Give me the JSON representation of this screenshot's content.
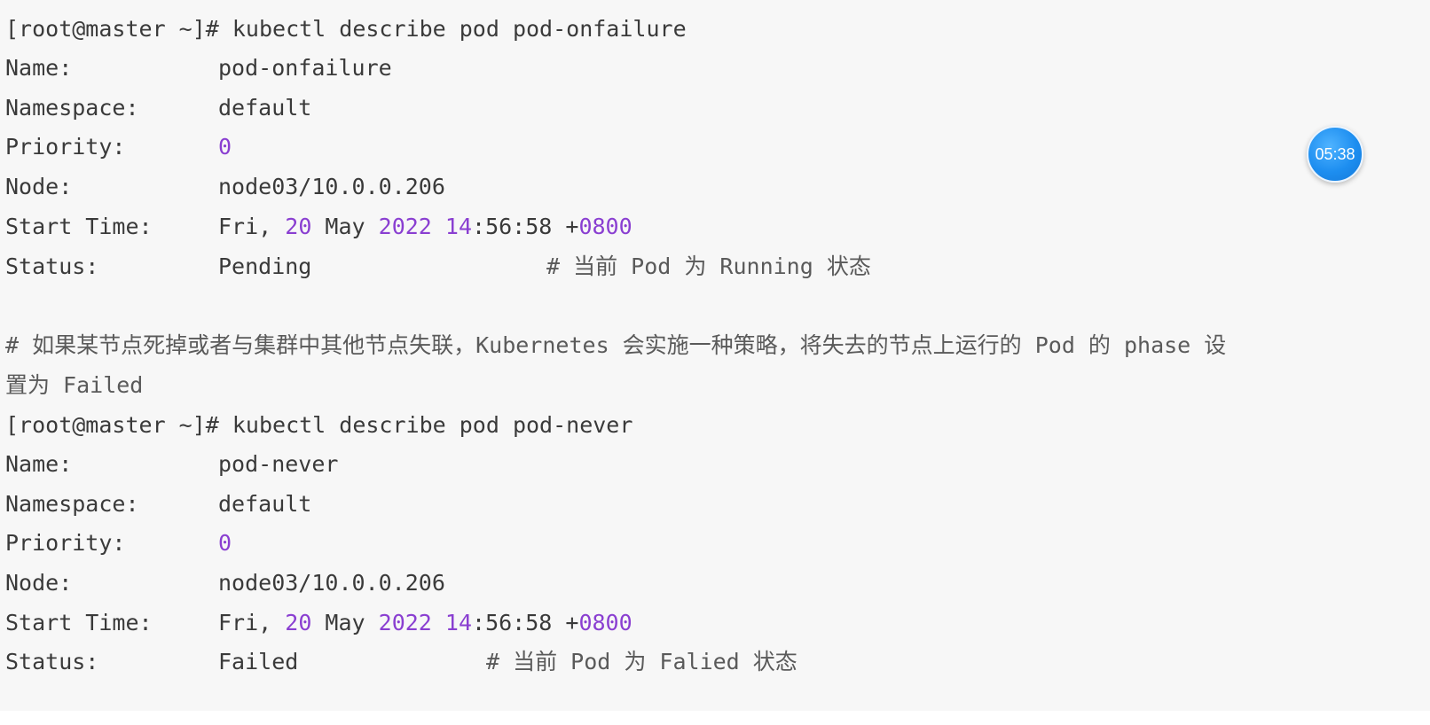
{
  "block1": {
    "command": "[root@master ~]# kubectl describe pod pod-onfailure",
    "name_key": "Name:",
    "name_val": "pod-onfailure",
    "namespace_key": "Namespace:",
    "namespace_val": "default",
    "priority_key": "Priority:",
    "priority_val": "0",
    "node_key": "Node:",
    "node_val": "node03/10.0.0.206",
    "start_key": "Start Time:",
    "start_day": "Fri, ",
    "start_date": "20",
    "start_month": " May ",
    "start_year": "2022",
    "start_space": " ",
    "start_hour": "14",
    "start_minsec": ":56:58 +",
    "start_tz": "0800",
    "status_key": "Status:",
    "status_val": "Pending",
    "status_comment": "# 当前 Pod 为 Running 状态"
  },
  "note_line1": "# 如果某节点死掉或者与集群中其他节点失联，Kubernetes 会实施一种策略，将失去的节点上运行的 Pod 的 phase 设",
  "note_line2": "置为 Failed",
  "block2": {
    "command": "[root@master ~]# kubectl describe pod pod-never",
    "name_key": "Name:",
    "name_val": "pod-never",
    "namespace_key": "Namespace:",
    "namespace_val": "default",
    "priority_key": "Priority:",
    "priority_val": "0",
    "node_key": "Node:",
    "node_val": "node03/10.0.0.206",
    "start_key": "Start Time:",
    "start_day": "Fri, ",
    "start_date": "20",
    "start_month": " May ",
    "start_year": "2022",
    "start_space": " ",
    "start_hour": "14",
    "start_minsec": ":56:58 +",
    "start_tz": "0800",
    "status_key": "Status:",
    "status_val": "Failed",
    "status_comment": "# 当前 Pod 为 Falied 状态"
  },
  "timer": {
    "time": "05:38"
  },
  "colors": {
    "background": "#f7f7f7",
    "text": "#3a3a3a",
    "number": "#8a3fd1",
    "timer": "#1d8ef0"
  }
}
